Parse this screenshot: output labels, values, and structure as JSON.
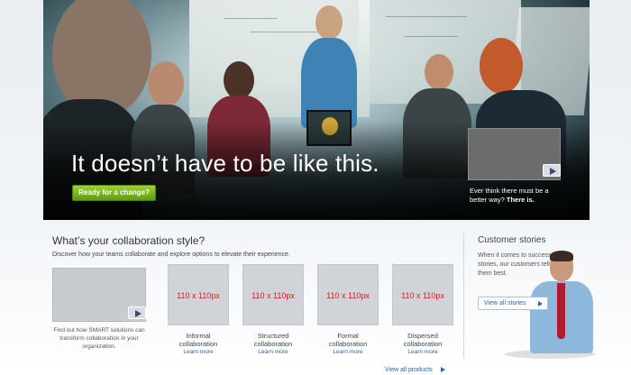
{
  "hero": {
    "headline": "It doesn’t have to be like this.",
    "cta_label": "Ready for a change?",
    "video_caption_line1": "Ever think there must be a",
    "video_caption_line2": "better way?",
    "video_caption_emphasis": "There is."
  },
  "collab": {
    "title": "What’s your collaboration style?",
    "description": "Discover how your teams collaborate and explore options to elevate their experience.",
    "smart_text": "Find out how SMART solutions can transform collaboration in your organization.",
    "styles": [
      {
        "placeholder": "110 x 110px",
        "name_line1": "Informal",
        "name_line2": "collaboration",
        "link": "Learn more"
      },
      {
        "placeholder": "110 x 110px",
        "name_line1": "Structured",
        "name_line2": "collaboration",
        "link": "Learn more"
      },
      {
        "placeholder": "110 x 110px",
        "name_line1": "Formal",
        "name_line2": "collaboration",
        "link": "Learn more"
      },
      {
        "placeholder": "110 x 110px",
        "name_line1": "Dispersed",
        "name_line2": "collaboration",
        "link": "Learn more"
      }
    ],
    "view_all_label": "View all products"
  },
  "customers": {
    "title": "Customer stories",
    "text": "When it comes to success stories, our customers tell them best.",
    "button_label": "View all stories"
  },
  "colors": {
    "cta_green": "#6fae1d",
    "link_blue": "#2a64b4",
    "placeholder_red": "#d81a1a"
  }
}
